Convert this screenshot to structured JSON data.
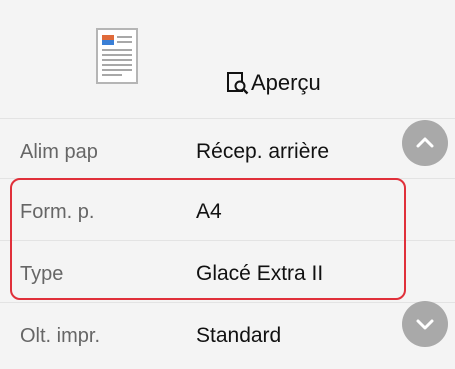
{
  "preview": {
    "label": "Aperçu",
    "icon": "preview-magnifier-icon",
    "document_icon": "document-thumbnail-icon"
  },
  "settings": [
    {
      "label": "Alim pap",
      "value": "Récep. arrière"
    },
    {
      "label": "Form. p.",
      "value": "A4"
    },
    {
      "label": "Type",
      "value": "Glacé Extra II"
    },
    {
      "label": "Olt. impr.",
      "value": "Standard"
    }
  ],
  "scroll": {
    "up_icon": "chevron-up-icon",
    "down_icon": "chevron-down-icon"
  },
  "colors": {
    "highlight": "#e0303a",
    "scroll_button": "#a9a9a9"
  }
}
